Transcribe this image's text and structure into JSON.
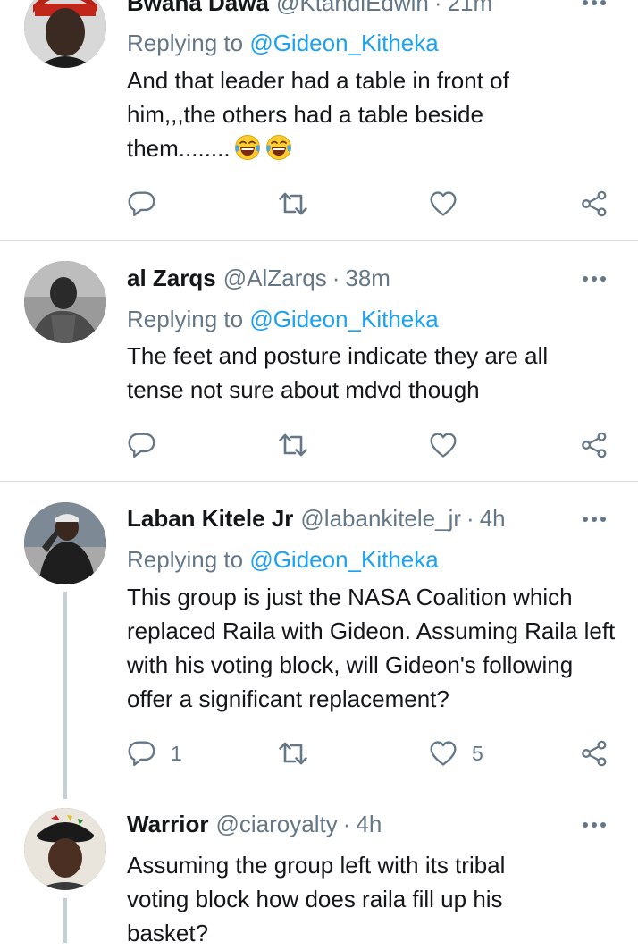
{
  "replying_to_label": "Replying to",
  "tweets": [
    {
      "display_name": "Bwana Dawa",
      "handle": "@KtandiEdwin",
      "separator": "·",
      "time": "21m",
      "reply_to": "@Gideon_Kitheka",
      "text_lines": [
        "And that leader had a table in front of",
        "him,,,the others had a table beside",
        "them........"
      ],
      "emojis": [
        "face-with-tears-of-joy",
        "face-with-tears-of-joy"
      ],
      "reply_count": "",
      "retweet_count": "",
      "like_count": ""
    },
    {
      "display_name": "al Zarqs",
      "handle": "@AlZarqs",
      "separator": "·",
      "time": "38m",
      "reply_to": "@Gideon_Kitheka",
      "text": "The feet and posture indicate they are all tense not sure about mdvd though",
      "reply_count": "",
      "retweet_count": "",
      "like_count": ""
    },
    {
      "display_name": "Laban Kitele Jr",
      "handle": "@labankitele_jr",
      "separator": "·",
      "time": "4h",
      "reply_to": "@Gideon_Kitheka",
      "text": "This group is just the NASA Coalition which replaced Raila with Gideon. Assuming Raila left with his voting block, will Gideon's following offer a significant replacement?",
      "reply_count": "1",
      "retweet_count": "",
      "like_count": "5"
    },
    {
      "display_name": "Warrior",
      "handle": "@ciaroyalty",
      "separator": "·",
      "time": "4h",
      "text": "Assuming the group left with its tribal voting block how does raila fill up his basket?"
    }
  ],
  "icons": {
    "more": "more-options-icon",
    "reply": "reply-icon",
    "retweet": "retweet-icon",
    "like": "heart-icon",
    "share": "share-icon"
  },
  "colors": {
    "link": "#1da1f2",
    "secondary": "#657786",
    "icon": "#657786",
    "divider": "#d6dde3",
    "thread_line": "#c4cfd6"
  }
}
